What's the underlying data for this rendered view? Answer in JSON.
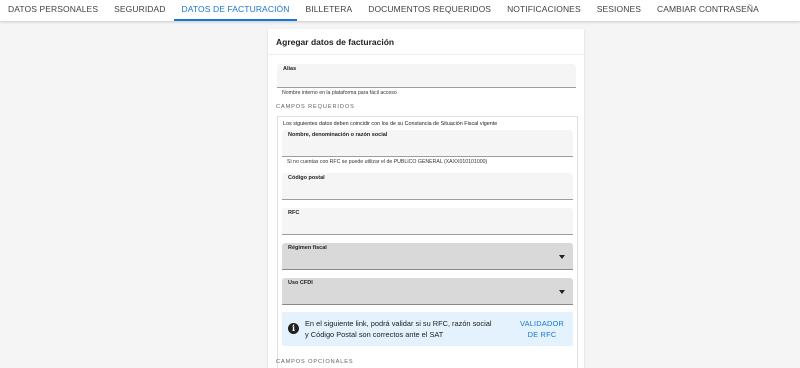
{
  "tabs": [
    {
      "label": "DATOS PERSONALES"
    },
    {
      "label": "SEGURIDAD"
    },
    {
      "label": "DATOS DE FACTURACIÓN"
    },
    {
      "label": "BILLETERA"
    },
    {
      "label": "DOCUMENTOS REQUERIDOS"
    },
    {
      "label": "NOTIFICACIONES"
    },
    {
      "label": "SESIONES"
    },
    {
      "label": "CAMBIAR CONTRASEÑA"
    }
  ],
  "active_tab": "DATOS DE FACTURACIÓN",
  "colors": {
    "accent": "#1976d2",
    "info_bg": "#e3f2fd",
    "page_bg": "#f5f5f5"
  },
  "card": {
    "title": "Agregar datos de facturación",
    "alias": {
      "label": "Alias",
      "value": "",
      "hint": "Nombre interno en la plataforma para fácil acceso"
    },
    "required_section_label": "CAMPOS REQUERIDOS",
    "required_intro": "Los siguientes datos deben coincidir con los de su Constancia de Situación Fiscal vigente",
    "razon_social": {
      "label": "Nombre, denominación o razón social",
      "value": "",
      "hint": "Si no cuentas con RFC se puede utilizar el de PUBLICO GENERAL (XAXX010101000)"
    },
    "codigo_postal": {
      "label": "Código postal",
      "value": ""
    },
    "rfc": {
      "label": "RFC",
      "value": ""
    },
    "regimen_fiscal": {
      "label": "Régimen fiscal",
      "value": "",
      "icon": "arrow-drop-down-icon"
    },
    "uso_cfdi": {
      "label": "Uso CFDI",
      "value": "",
      "icon": "arrow-drop-down-icon"
    },
    "info": {
      "icon": "info-icon",
      "text": "En el siguiente link, podrá validar si su RFC, razón social y Código Postal son correctos ante el SAT",
      "link_label": "VALIDADOR DE RFC"
    },
    "optional_section_label": "CAMPOS OPCIONALES"
  }
}
